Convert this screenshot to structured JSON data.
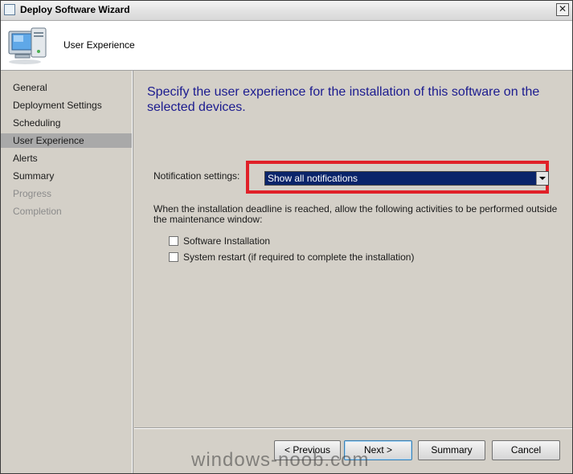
{
  "window": {
    "title": "Deploy Software Wizard",
    "close_glyph": "✕"
  },
  "header": {
    "title": "User Experience",
    "icon": "computer-monitor-icon"
  },
  "sidebar": {
    "items": [
      {
        "label": "General",
        "state": "normal"
      },
      {
        "label": "Deployment Settings",
        "state": "normal"
      },
      {
        "label": "Scheduling",
        "state": "normal"
      },
      {
        "label": "User Experience",
        "state": "active"
      },
      {
        "label": "Alerts",
        "state": "normal"
      },
      {
        "label": "Summary",
        "state": "normal"
      },
      {
        "label": "Progress",
        "state": "disabled"
      },
      {
        "label": "Completion",
        "state": "disabled"
      }
    ]
  },
  "main": {
    "heading": "Specify the user experience for the installation of this software on the selected devices.",
    "notification_label": "Notification settings:",
    "notification_value": "Show all notifications",
    "deadline_text": "When the installation deadline is reached, allow the following activities to be performed outside the maintenance window:",
    "options": [
      {
        "label": "Software Installation",
        "checked": false
      },
      {
        "label": "System restart  (if required to complete the installation)",
        "checked": false
      }
    ]
  },
  "footer": {
    "previous": "< Previous",
    "next": "Next >",
    "summary": "Summary",
    "cancel": "Cancel"
  },
  "watermark": "windows-noob.com",
  "colors": {
    "highlight_frame": "#e02028",
    "heading": "#1b1b8f",
    "selection": "#0a246a"
  }
}
